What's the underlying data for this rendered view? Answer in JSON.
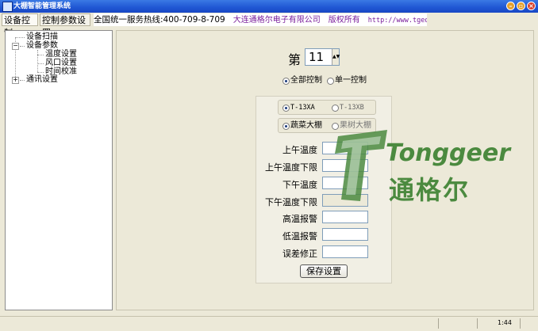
{
  "window": {
    "title": "大棚智能管理系统"
  },
  "toolbar": {
    "tabs": [
      {
        "label": "设备控制"
      },
      {
        "label": "控制参数设置"
      }
    ],
    "hotline_label": "全国统一服务热线:400-709-8-709",
    "company": "大连通格尔电子有限公司",
    "rights": "版权所有",
    "url": "http://www.tgedz.com"
  },
  "tree": {
    "items": [
      {
        "label": "设备扫描"
      },
      {
        "label": "设备参数"
      },
      {
        "label": "温度设置"
      },
      {
        "label": "风口设置"
      },
      {
        "label": "时间校准"
      },
      {
        "label": "通讯设置"
      }
    ]
  },
  "selector": {
    "prefix": "第",
    "value": "11"
  },
  "control_mode": {
    "options": [
      {
        "label": "全部控制",
        "selected": true
      },
      {
        "label": "单一控制",
        "selected": false
      }
    ]
  },
  "model": {
    "options": [
      {
        "label": "T-13XA",
        "selected": true
      },
      {
        "label": "T-13XB",
        "selected": false
      }
    ]
  },
  "greenhouse": {
    "options": [
      {
        "label": "蔬菜大棚",
        "selected": true
      },
      {
        "label": "果树大棚",
        "selected": false
      }
    ]
  },
  "fields": [
    {
      "label": "上午温度",
      "value": ""
    },
    {
      "label": "上午温度下限",
      "value": ""
    },
    {
      "label": "下午温度",
      "value": ""
    },
    {
      "label": "下午温度下限",
      "value": ""
    },
    {
      "label": "高温报警",
      "value": ""
    },
    {
      "label": "低温报警",
      "value": ""
    },
    {
      "label": "误差修正",
      "value": ""
    }
  ],
  "save_label": "保存设置",
  "status": {
    "time": "1:44"
  },
  "watermark": {
    "brand_en": "Tonggeer",
    "brand_cn": "通格尔"
  },
  "colors": {
    "titlebar": "#1f56d3",
    "watermark": "#4b8a3f",
    "link": "#7a1e9b"
  }
}
